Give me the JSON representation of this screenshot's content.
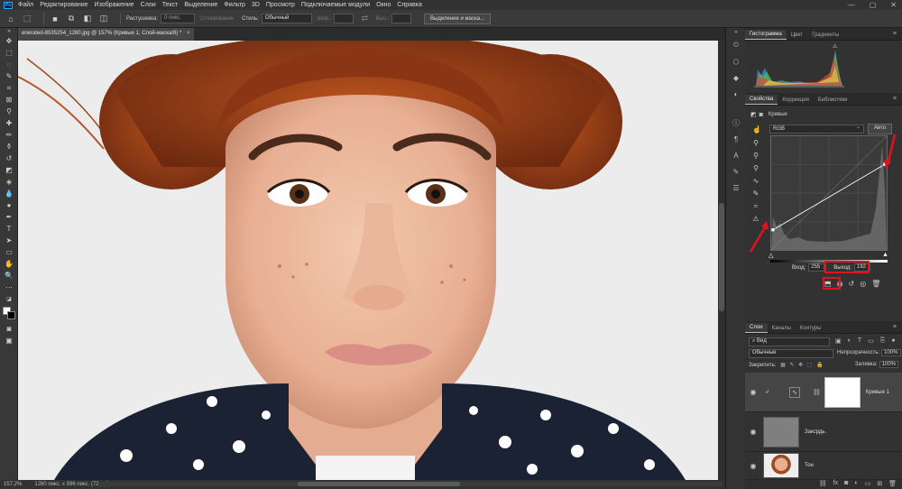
{
  "menubar": {
    "app_logo": "Ps",
    "items": [
      "Файл",
      "Редактирование",
      "Изображение",
      "Слои",
      "Текст",
      "Выделение",
      "Фильтр",
      "3D",
      "Просмотр",
      "Подключаемые модули",
      "Окно",
      "Справка"
    ]
  },
  "options_bar": {
    "feather_label": "Растушевка:",
    "feather_value": "0 пикс.",
    "antialias_label": "Сглаживание",
    "style_label": "Стиль:",
    "style_value": "Обычный",
    "width_label": "Шир.:",
    "height_label": "Выс.:",
    "select_mask_button": "Выделение и маска..."
  },
  "document": {
    "tab_title": "enerated-8535254_1280.jpg @ 157% (Кривые 1, Слой-маска/8) *",
    "tab_close": "×"
  },
  "status": {
    "zoom": "157,2%",
    "dimensions": "1280 пикс. х 996 пикс. (72 ppi)"
  },
  "top_panel": {
    "tabs": [
      "Гистограмма",
      "Цвет",
      "Градиенты"
    ],
    "active": "Гистограмма"
  },
  "properties": {
    "tabs": [
      "Свойства",
      "Коррекция",
      "Библиотеки"
    ],
    "active": "Свойства",
    "adjustment_title": "Кривые",
    "channel": "RGB",
    "auto_button": "Авто",
    "input_label": "Вход:",
    "input_value": "255",
    "output_label": "Выход:",
    "output_value": "192",
    "curve_points": [
      [
        0,
        45
      ],
      [
        255,
        192
      ]
    ]
  },
  "layers": {
    "tabs": [
      "Слои",
      "Каналы",
      "Контуры"
    ],
    "active": "Слои",
    "filter_value": "Вид",
    "blend_mode": "Обычные",
    "opacity_label": "Непрозрачность:",
    "opacity_value": "100%",
    "lock_label": "Закрепить:",
    "fill_label": "Заливка:",
    "fill_value": "100%",
    "items": [
      {
        "name": "Кривые 1",
        "selected": true
      },
      {
        "name": "Заксрдь.",
        "selected": false
      },
      {
        "name": "Тон",
        "selected": false
      },
      {
        "name": "",
        "selected": false
      }
    ]
  },
  "colors": {
    "accent_red": "#e0141e",
    "panel_bg": "#323232"
  }
}
